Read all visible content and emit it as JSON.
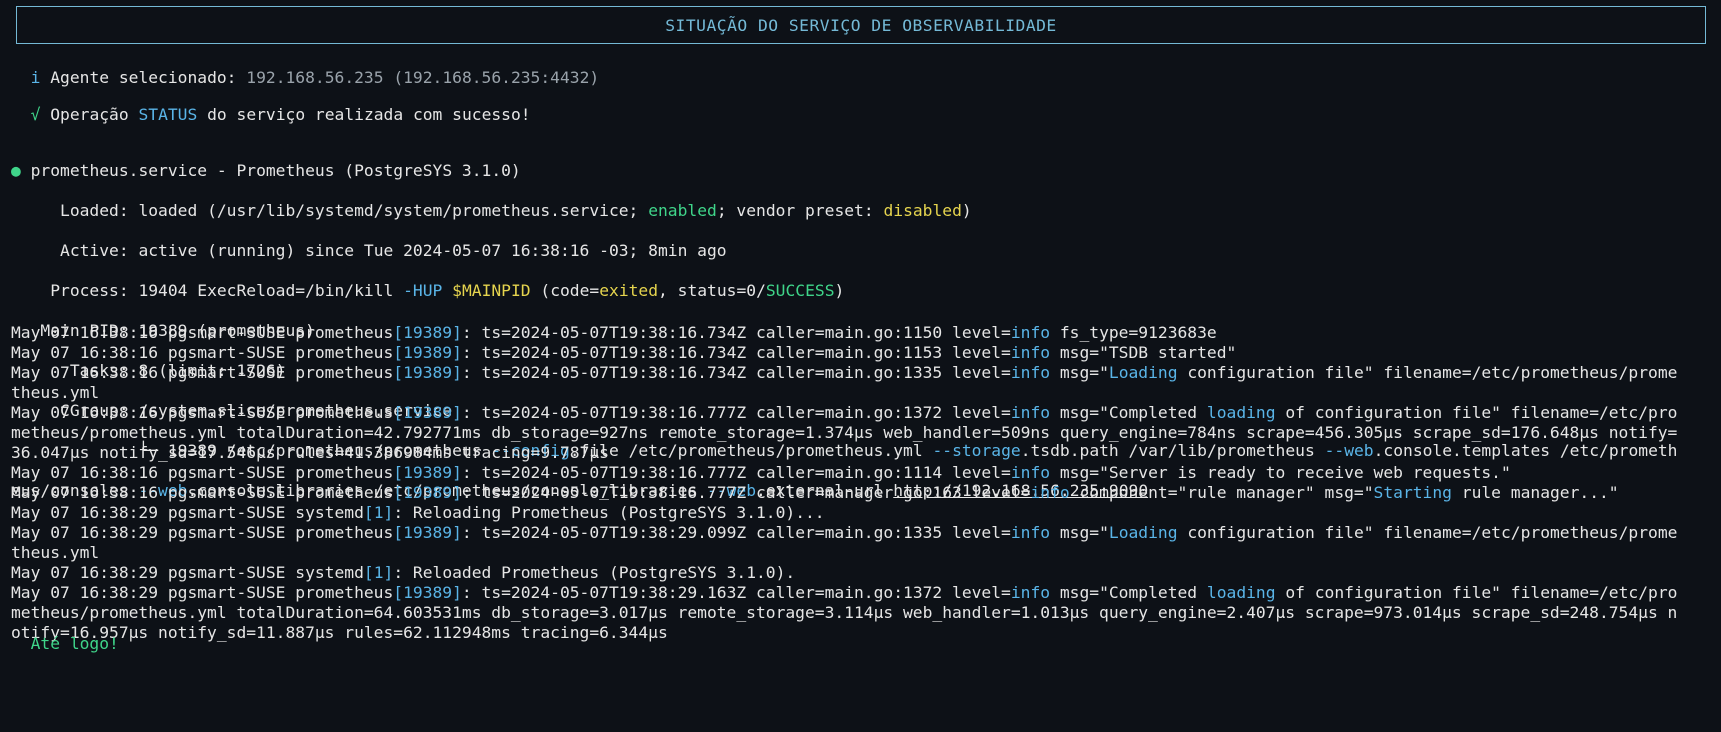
{
  "header": {
    "title": "SITUAÇÃO DO SERVIÇO DE OBSERVABILIDADE"
  },
  "agent": {
    "icon": "i",
    "label": "Agente selecionado:",
    "value": "192.168.56.235 (192.168.56.235:4432)"
  },
  "operation": {
    "icon": "√",
    "prefix": "Operação",
    "action": "STATUS",
    "suffix": "do serviço realizada com sucesso!"
  },
  "service": {
    "bullet": "●",
    "name": "prometheus.service - Prometheus (PostgreSYS 3.1.0)",
    "loaded_label": "Loaded:",
    "loaded_a": "loaded (/usr/lib/systemd/system/prometheus.service;",
    "loaded_enabled": "enabled",
    "loaded_b": "; vendor preset:",
    "loaded_disabled": "disabled",
    "loaded_c": ")",
    "active_label": "Active:",
    "active_value": "active (running) since Tue 2024-05-07 16:38:16 -03; 8min ago",
    "process_label": "Process:",
    "process_a": "19404 ExecReload=/bin/kill",
    "process_hup": "-HUP",
    "process_mainpid": "$MAINPID",
    "process_b": "(code=",
    "process_exited": "exited",
    "process_c": ", status=0/",
    "process_success": "SUCCESS",
    "process_d": ")",
    "mainpid_label": "Main PID:",
    "mainpid_value": "19389 (prometheus)",
    "tasks_label": "Tasks:",
    "tasks_value": "8 (limit: 1726)",
    "cgroup_label": "CGroup:",
    "cgroup_value": "/system.slice/prometheus.service",
    "cmd_tree": "└─",
    "cmd_a": "19389 /etc/prometheus/prometheus",
    "cmd_config_flag": "--config",
    "cmd_b": ".file /etc/prometheus/prometheus.yml",
    "cmd_storage_flag": "--storage",
    "cmd_c": ".tsdb.path /var/lib/prometheus",
    "cmd_web_flag1": "--web",
    "cmd_d": ".console.templates /etc/prometh",
    "cmd_e": "eus/consoles",
    "cmd_web_flag2": "--web",
    "cmd_f": ".console.libraries /etc/prometheus/console_libraries",
    "cmd_web_flag3": "--web",
    "cmd_g": ".external-url",
    "cmd_url": "http://192.168.56.235:9090"
  },
  "logs": [
    {
      "pre": "May 07 16:38:16 pgsmart-SUSE prometheus",
      "pid": "[19389]",
      "a": ": ts=2024-05-07T19:38:16.734Z caller=main.go:1150 level=",
      "lvl": "info",
      "b": " fs_type=9123683e"
    },
    {
      "pre": "May 07 16:38:16 pgsmart-SUSE prometheus",
      "pid": "[19389]",
      "a": ": ts=2024-05-07T19:38:16.734Z caller=main.go:1153 level=",
      "lvl": "info",
      "b": " msg=\"TSDB started\""
    },
    {
      "pre": "May 07 16:38:16 pgsmart-SUSE prometheus",
      "pid": "[19389]",
      "a": ": ts=2024-05-07T19:38:16.734Z caller=main.go:1335 level=",
      "lvl": "info",
      "b": " msg=\"",
      "kw": "Loading",
      "c": " configuration file\" filename=/etc/prometheus/prome"
    },
    {
      "cont": "theus.yml"
    },
    {
      "pre": "May 07 16:38:16 pgsmart-SUSE prometheus",
      "pid": "[19389]",
      "a": ": ts=2024-05-07T19:38:16.777Z caller=main.go:1372 level=",
      "lvl": "info",
      "b": " msg=\"Completed ",
      "kw": "loading",
      "c": " of configuration file\" filename=/etc/pro"
    },
    {
      "cont": "metheus/prometheus.yml totalDuration=42.792771ms db_storage=927ns remote_storage=1.374µs web_handler=509ns query_engine=784ns scrape=456.305µs scrape_sd=176.648µs notify="
    },
    {
      "cont": "36.047µs notify_sd=17.546µs rules=41.386984ms tracing=9.787µs"
    },
    {
      "pre": "May 07 16:38:16 pgsmart-SUSE prometheus",
      "pid": "[19389]",
      "a": ": ts=2024-05-07T19:38:16.777Z caller=main.go:1114 level=",
      "lvl": "info",
      "b": " msg=\"Server is ready to receive web requests.\""
    },
    {
      "pre": "May 07 16:38:16 pgsmart-SUSE prometheus",
      "pid": "[19389]",
      "a": ": ts=2024-05-07T19:38:16.777Z caller=manager.go:163 level=",
      "lvl": "info",
      "b": " component=\"rule manager\" msg=\"",
      "kw": "Starting",
      "c": " rule manager...\""
    },
    {
      "pre": "May 07 16:38:29 pgsmart-SUSE systemd",
      "pid": "[1]",
      "a": ": Reloading Prometheus (PostgreSYS 3.1.0)..."
    },
    {
      "pre": "May 07 16:38:29 pgsmart-SUSE prometheus",
      "pid": "[19389]",
      "a": ": ts=2024-05-07T19:38:29.099Z caller=main.go:1335 level=",
      "lvl": "info",
      "b": " msg=\"",
      "kw": "Loading",
      "c": " configuration file\" filename=/etc/prometheus/prome"
    },
    {
      "cont": "theus.yml"
    },
    {
      "pre": "May 07 16:38:29 pgsmart-SUSE systemd",
      "pid": "[1]",
      "a": ": Reloaded Prometheus (PostgreSYS 3.1.0)."
    },
    {
      "pre": "May 07 16:38:29 pgsmart-SUSE prometheus",
      "pid": "[19389]",
      "a": ": ts=2024-05-07T19:38:29.163Z caller=main.go:1372 level=",
      "lvl": "info",
      "b": " msg=\"Completed ",
      "kw": "loading",
      "c": " of configuration file\" filename=/etc/pro"
    },
    {
      "cont": "metheus/prometheus.yml totalDuration=64.603531ms db_storage=3.017µs remote_storage=3.114µs web_handler=1.013µs query_engine=2.407µs scrape=973.014µs scrape_sd=248.754µs n"
    },
    {
      "cont": "otify=16.957µs notify_sd=11.887µs rules=62.112948ms tracing=6.344µs"
    }
  ],
  "farewell": "Até logo!"
}
